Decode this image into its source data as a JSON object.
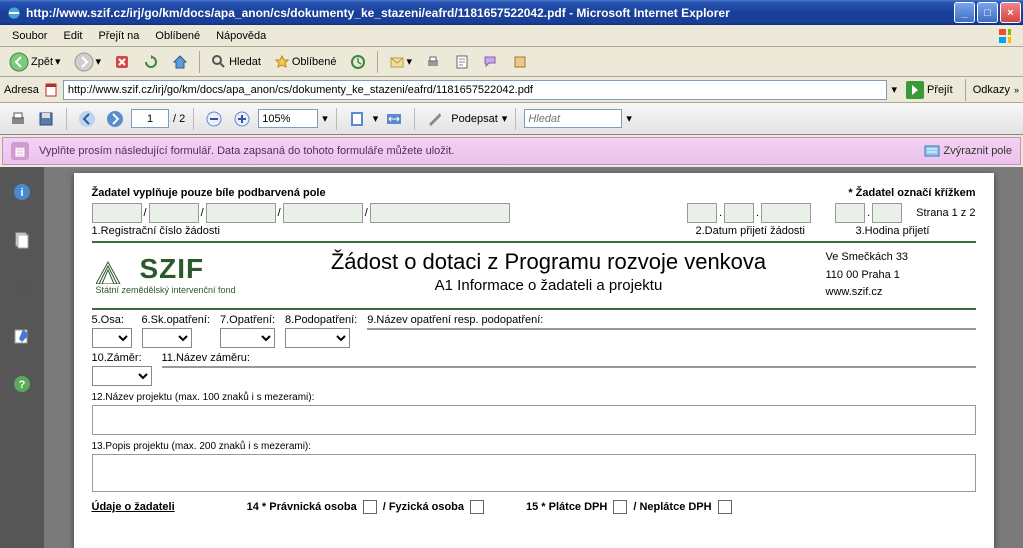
{
  "window": {
    "title": "http://www.szif.cz/irj/go/km/docs/apa_anon/cs/dokumenty_ke_stazeni/eafrd/1181657522042.pdf - Microsoft Internet Explorer"
  },
  "menu": {
    "file": "Soubor",
    "edit": "Edit",
    "go": "Přejít na",
    "fav": "Oblíbené",
    "help": "Nápověda"
  },
  "toolbar": {
    "back": "Zpět",
    "search": "Hledat",
    "favorites": "Oblíbené"
  },
  "address": {
    "label": "Adresa",
    "url": "http://www.szif.cz/irj/go/km/docs/apa_anon/cs/dokumenty_ke_stazeni/eafrd/1181657522042.pdf",
    "go": "Přejít",
    "links": "Odkazy"
  },
  "pdf": {
    "page": "1",
    "total": "/ 2",
    "zoom": "105%",
    "sign": "Podepsat",
    "search_ph": "Hledat"
  },
  "notify": {
    "text": "Vyplňte prosím následující formulář. Data zapsaná do tohoto formuláře můžete uložit.",
    "highlight": "Zvýraznit pole"
  },
  "form": {
    "header_left": "Žadatel vyplňuje pouze bíle podbarvená pole",
    "header_right": "* Žadatel označí křížkem",
    "page_info": "Strana 1 z 2",
    "lbl1": "1.Registrační číslo žádosti",
    "lbl2": "2.Datum přijetí žádosti",
    "lbl3": "3.Hodina přijetí",
    "title_main": "Žádost o dotaci z Programu rozvoje venkova",
    "title_sub": "A1 Informace o žadateli a projektu",
    "addr1": "Ve Smečkách 33",
    "addr2": "110 00 Praha 1",
    "addr3": "www.szif.cz",
    "logo": "SZIF",
    "logo_sub": "Státní zemědělský intervenční fond",
    "f5": "5.Osa:",
    "f6": "6.Sk.opatření:",
    "f7": "7.Opatření:",
    "f8": "8.Podopatření:",
    "f9": "9.Název opatření resp. podopatření:",
    "f10": "10.Záměr:",
    "f11": "11.Název záměru:",
    "f12": "12.Název projektu (max. 100 znaků i s mezerami):",
    "f13": "13.Popis projektu (max. 200 znaků i s mezerami):",
    "sec_title": "Údaje o žadateli",
    "f14": "14 * Právnická osoba",
    "f14b": "/  Fyzická osoba",
    "f15": "15 * Plátce DPH",
    "f15b": "/  Neplátce DPH"
  }
}
